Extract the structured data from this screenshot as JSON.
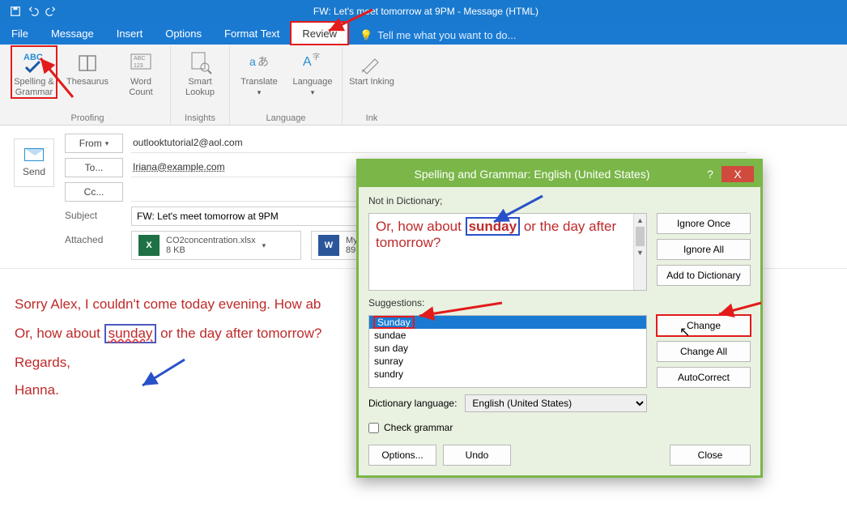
{
  "titlebar": {
    "title": "FW: Let's meet tomorrow at 9PM - Message (HTML)"
  },
  "menu": {
    "file": "File",
    "message": "Message",
    "insert": "Insert",
    "options": "Options",
    "formattext": "Format Text",
    "review": "Review",
    "tellme": "Tell me what you want to do..."
  },
  "ribbon": {
    "spelling": "Spelling & Grammar",
    "thesaurus": "Thesaurus",
    "wordcount": "Word Count",
    "smartlookup": "Smart Lookup",
    "translate": "Translate",
    "language": "Language",
    "startinking": "Start Inking",
    "group_proofing": "Proofing",
    "group_insights": "Insights",
    "group_language": "Language",
    "group_ink": "Ink"
  },
  "compose": {
    "send": "Send",
    "from_btn": "From",
    "to_btn": "To...",
    "cc_btn": "Cc...",
    "subject_label": "Subject",
    "attached_label": "Attached",
    "from_value": "outlooktutorial2@aol.com",
    "to_value": "Iriana@example.com",
    "cc_value": "",
    "subject_value": "FW: Let's meet tomorrow at 9PM",
    "attachments": [
      {
        "name": "CO2concentration.xlsx",
        "size": "8 KB",
        "type": "xl"
      },
      {
        "name": "My",
        "size": "89",
        "type": "wd"
      }
    ]
  },
  "body": {
    "line1a": "Sorry Alex, I couldn't come today evening. How ab",
    "line2a": "Or, how about ",
    "sunday": "sunday",
    "line2b": " or the day after tomorrow?",
    "regards": "Regards,",
    "name": "Hanna."
  },
  "dialog": {
    "title": "Spelling and Grammar: English (United States)",
    "not_in_dict_label": "Not in Dictionary;",
    "context_pre": "Or, how about ",
    "context_word": "sunday",
    "context_post": " or the day after tomorrow?",
    "suggestions_label": "Suggestions:",
    "suggestions": [
      "Sunday",
      "sundae",
      "sun day",
      "sunray",
      "sundry"
    ],
    "dictlang_label": "Dictionary language:",
    "dictlang_value": "English (United States)",
    "check_grammar": "Check grammar",
    "btn_ignore_once": "Ignore Once",
    "btn_ignore_all": "Ignore All",
    "btn_add": "Add to Dictionary",
    "btn_change": "Change",
    "btn_change_all": "Change All",
    "btn_autocorrect": "AutoCorrect",
    "btn_options": "Options...",
    "btn_undo": "Undo",
    "btn_close": "Close",
    "help": "?",
    "close_x": "X"
  }
}
